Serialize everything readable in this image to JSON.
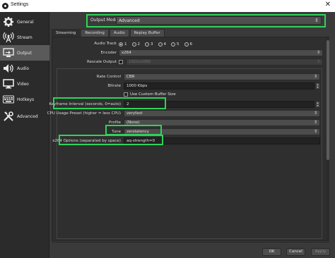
{
  "window": {
    "title": "Settings",
    "close_glyph": "✕"
  },
  "sidebar": {
    "items": [
      {
        "label": "General",
        "icon": "gear-icon"
      },
      {
        "label": "Stream",
        "icon": "broadcast-icon"
      },
      {
        "label": "Output",
        "icon": "output-icon",
        "active": true
      },
      {
        "label": "Audio",
        "icon": "speaker-icon"
      },
      {
        "label": "Video",
        "icon": "monitor-icon"
      },
      {
        "label": "Hotkeys",
        "icon": "keyboard-icon"
      },
      {
        "label": "Advanced",
        "icon": "tools-icon"
      }
    ]
  },
  "output_mode": {
    "label": "Output Mode",
    "value": "Advanced"
  },
  "tabs": [
    "Streaming",
    "Recording",
    "Audio",
    "Replay Buffer"
  ],
  "audio_track": {
    "label": "Audio Track",
    "options": [
      "1",
      "2",
      "3",
      "4",
      "5",
      "6"
    ],
    "selected": "1"
  },
  "encoder": {
    "label": "Encoder",
    "value": "x264"
  },
  "rescale_output": {
    "label": "Rescale Output",
    "value": "1920x1080",
    "checked": false
  },
  "rate_control": {
    "label": "Rate Control",
    "value": "CBR"
  },
  "bitrate": {
    "label": "Bitrate",
    "value": "1000 Kbps"
  },
  "custom_buffer": {
    "label": "Use Custom Buffer Size",
    "checked": false
  },
  "keyframe": {
    "label": "Keyframe Interval (seconds, 0=auto)",
    "value": "2"
  },
  "cpu_preset": {
    "label": "CPU Usage Preset (higher = less CPU)",
    "value": "veryfast"
  },
  "profile": {
    "label": "Profile",
    "value": "(None)"
  },
  "tune": {
    "label": "Tune",
    "value": "zerolatency"
  },
  "x264_options": {
    "label": "x264 Options (separated by space)",
    "value": "aq-strength=0"
  },
  "buttons": {
    "ok": "OK",
    "cancel": "Cancel",
    "apply": "Apply"
  },
  "colors": {
    "highlight": "#2fd35a",
    "window_bg": "#3a3a3a",
    "sidebar_bg": "#2b2b2b"
  }
}
